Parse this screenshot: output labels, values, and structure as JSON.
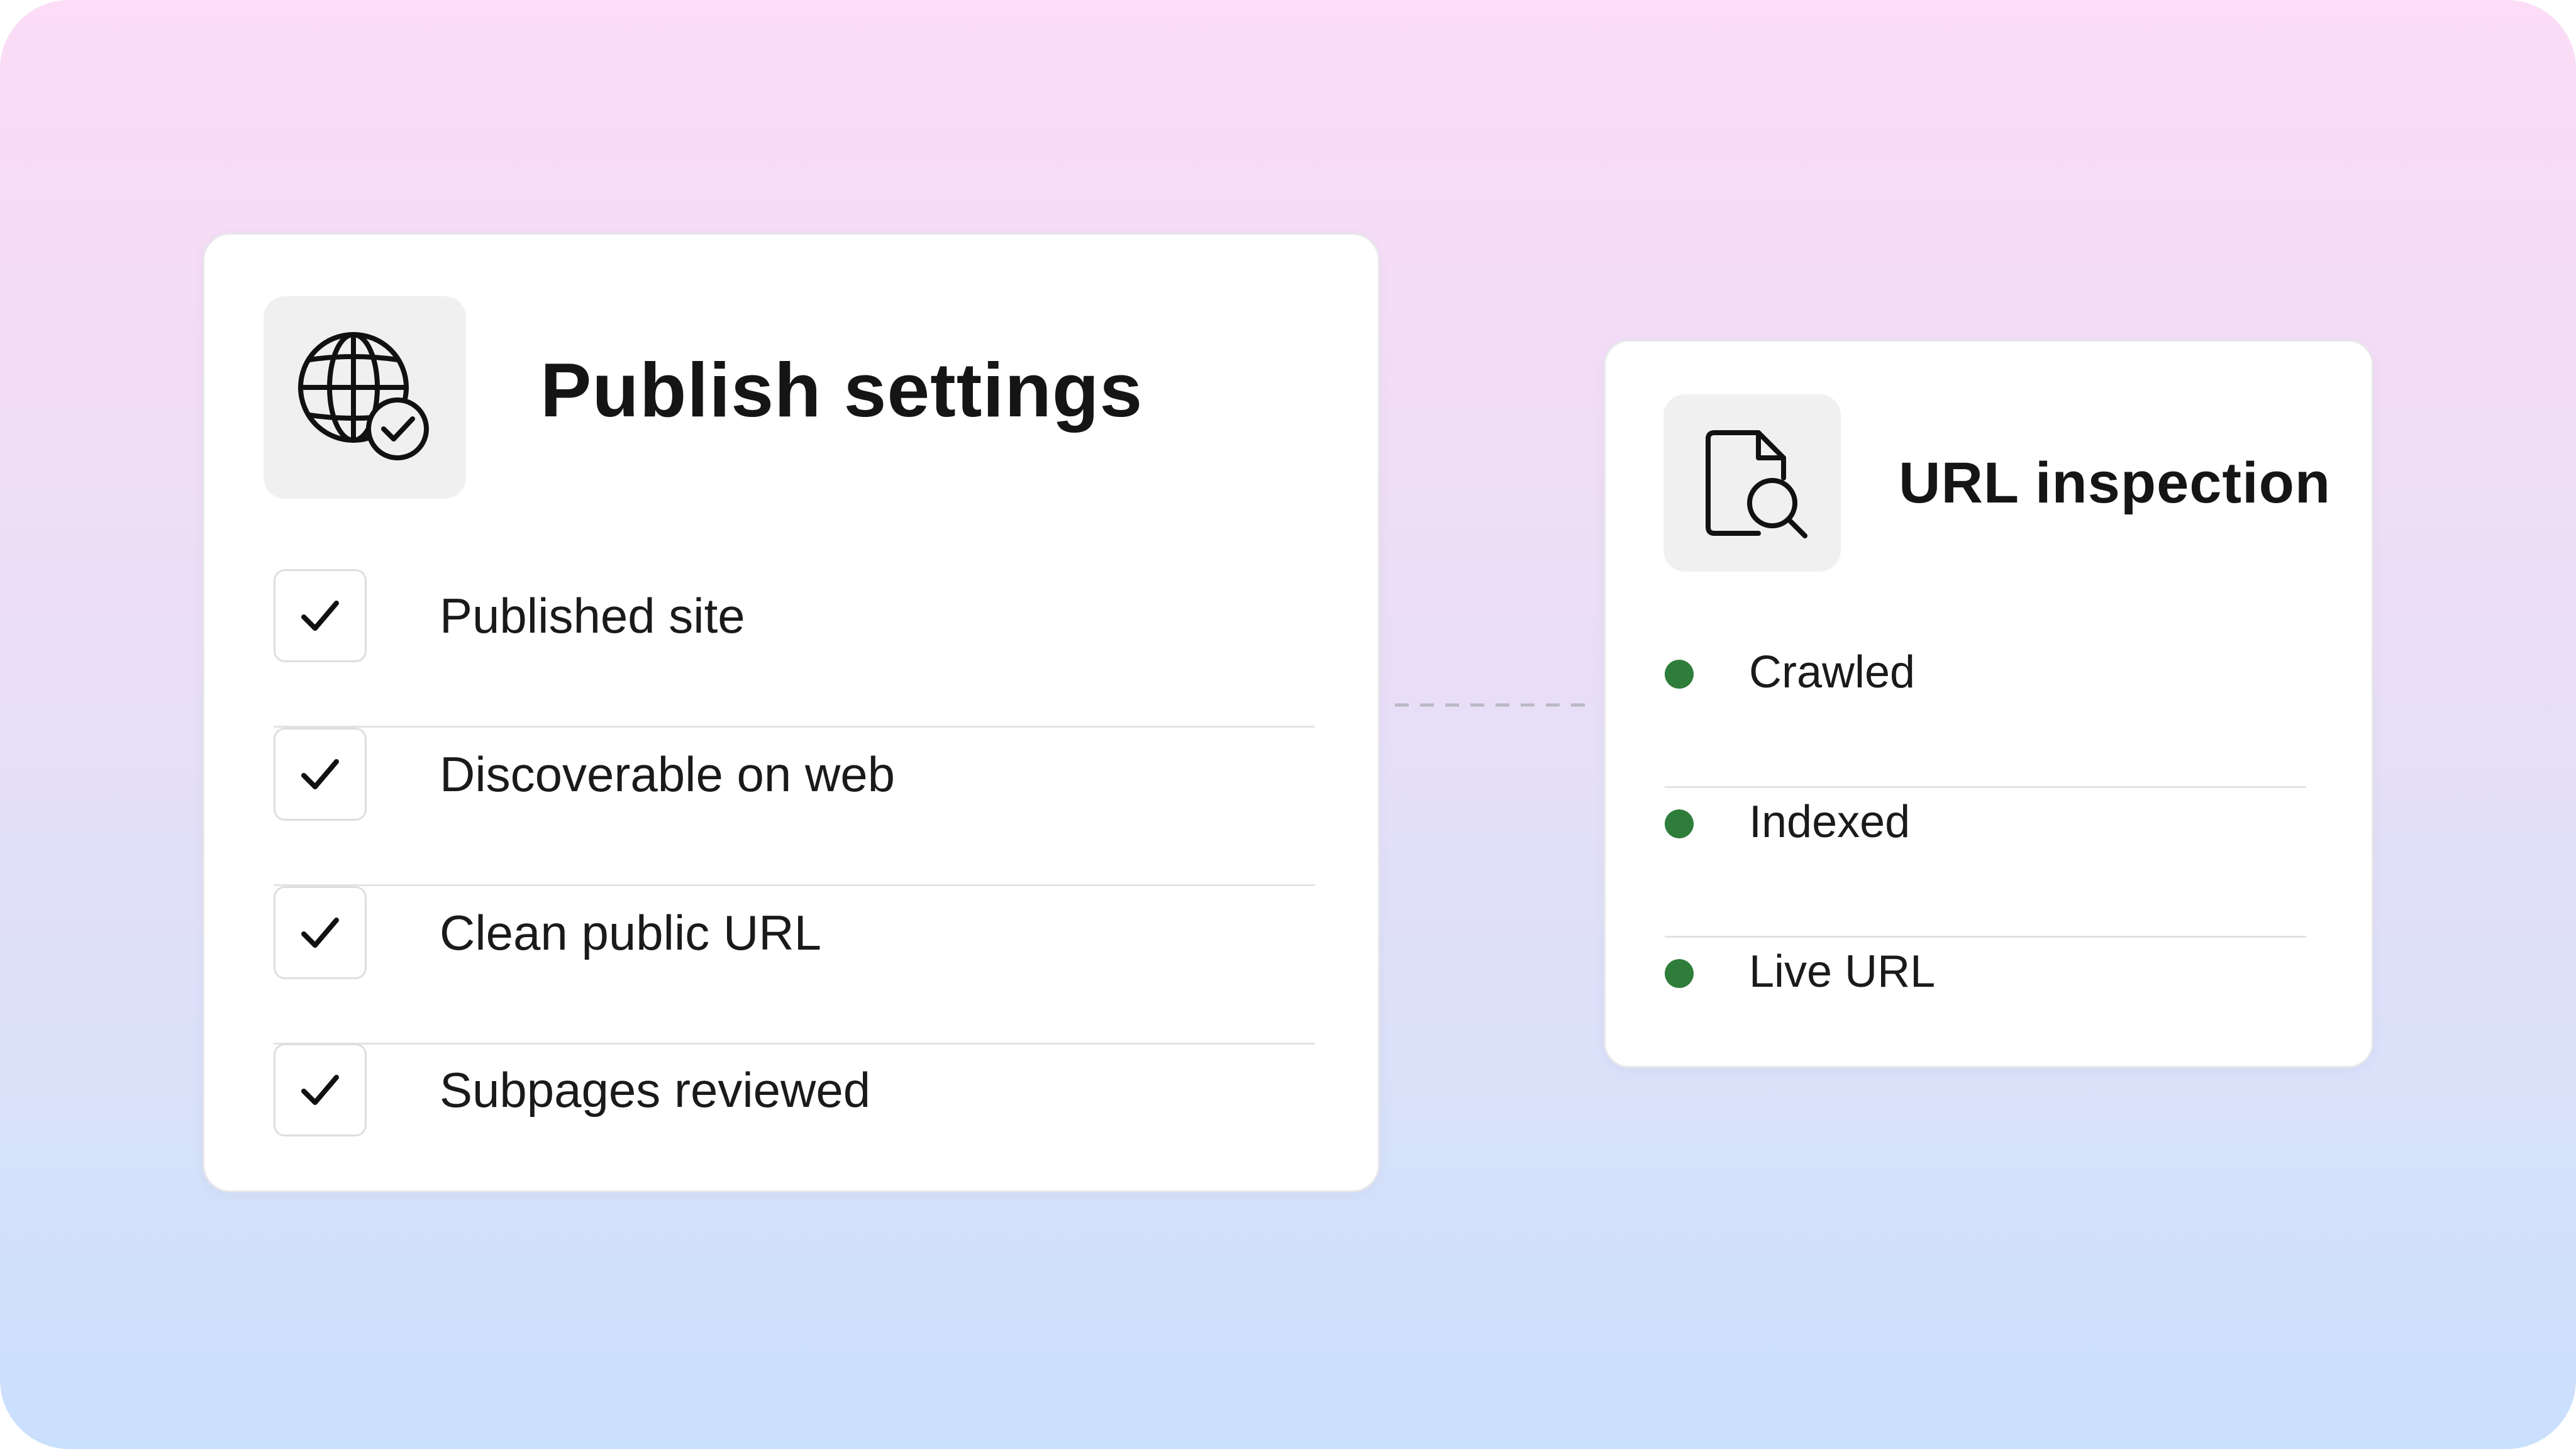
{
  "colors": {
    "status_ok": "#2e7d3a",
    "check": "#111111",
    "connector": "#b9b9c4"
  },
  "publish_settings": {
    "icon": "globe-check-icon",
    "title": "Publish settings",
    "items": [
      {
        "label": "Published site",
        "checked": true
      },
      {
        "label": "Discoverable on web",
        "checked": true
      },
      {
        "label": "Clean public URL",
        "checked": true
      },
      {
        "label": "Subpages reviewed",
        "checked": true
      }
    ]
  },
  "url_inspection": {
    "icon": "document-search-icon",
    "title": "URL inspection",
    "items": [
      {
        "label": "Crawled",
        "status": "ok"
      },
      {
        "label": "Indexed",
        "status": "ok"
      },
      {
        "label": "Live URL",
        "status": "ok"
      }
    ]
  }
}
